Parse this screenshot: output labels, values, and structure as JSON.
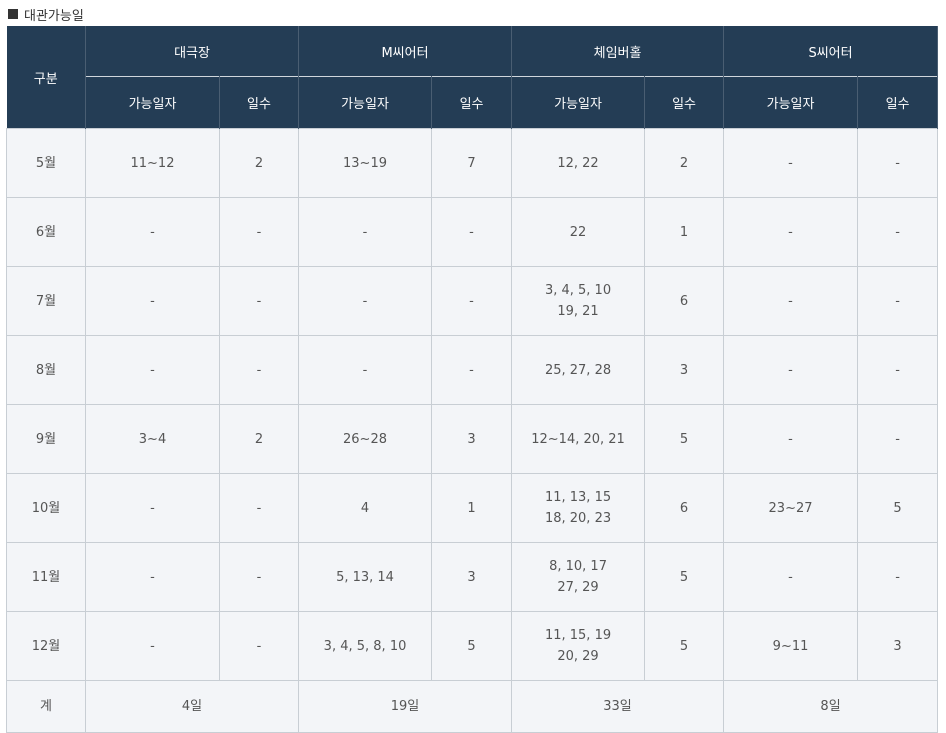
{
  "section_title": "대관가능일",
  "header": {
    "category": "구분",
    "venues": [
      "대극장",
      "M씨어터",
      "체임버홀",
      "S씨어터"
    ],
    "sub_date": "가능일자",
    "sub_days": "일수"
  },
  "rows": [
    {
      "month": "5월",
      "cells": [
        [
          "11~12"
        ],
        "2",
        [
          "13~19"
        ],
        "7",
        [
          "12, 22"
        ],
        "2",
        [
          "-"
        ],
        "-"
      ]
    },
    {
      "month": "6월",
      "cells": [
        [
          "-"
        ],
        "-",
        [
          "-"
        ],
        "-",
        [
          "22"
        ],
        "1",
        [
          "-"
        ],
        "-"
      ]
    },
    {
      "month": "7월",
      "cells": [
        [
          "-"
        ],
        "-",
        [
          "-"
        ],
        "-",
        [
          "3, 4, 5, 10",
          "19, 21"
        ],
        "6",
        [
          "-"
        ],
        "-"
      ]
    },
    {
      "month": "8월",
      "cells": [
        [
          "-"
        ],
        "-",
        [
          "-"
        ],
        "-",
        [
          "25, 27, 28"
        ],
        "3",
        [
          "-"
        ],
        "-"
      ]
    },
    {
      "month": "9월",
      "cells": [
        [
          "3~4"
        ],
        "2",
        [
          "26~28"
        ],
        "3",
        [
          "12~14, 20, 21"
        ],
        "5",
        [
          "-"
        ],
        "-"
      ]
    },
    {
      "month": "10월",
      "cells": [
        [
          "-"
        ],
        "-",
        [
          "4"
        ],
        "1",
        [
          "11, 13, 15",
          "18, 20, 23"
        ],
        "6",
        [
          "23~27"
        ],
        "5"
      ]
    },
    {
      "month": "11월",
      "cells": [
        [
          "-"
        ],
        "-",
        [
          "5, 13, 14"
        ],
        "3",
        [
          "8, 10, 17",
          "27, 29"
        ],
        "5",
        [
          "-"
        ],
        "-"
      ]
    },
    {
      "month": "12월",
      "cells": [
        [
          "-"
        ],
        "-",
        [
          "3, 4, 5, 8, 10"
        ],
        "5",
        [
          "11, 15, 19",
          "20, 29"
        ],
        "5",
        [
          "9~11"
        ],
        "3"
      ]
    }
  ],
  "total": {
    "label": "계",
    "values": [
      "4일",
      "19일",
      "33일",
      "8일"
    ]
  }
}
